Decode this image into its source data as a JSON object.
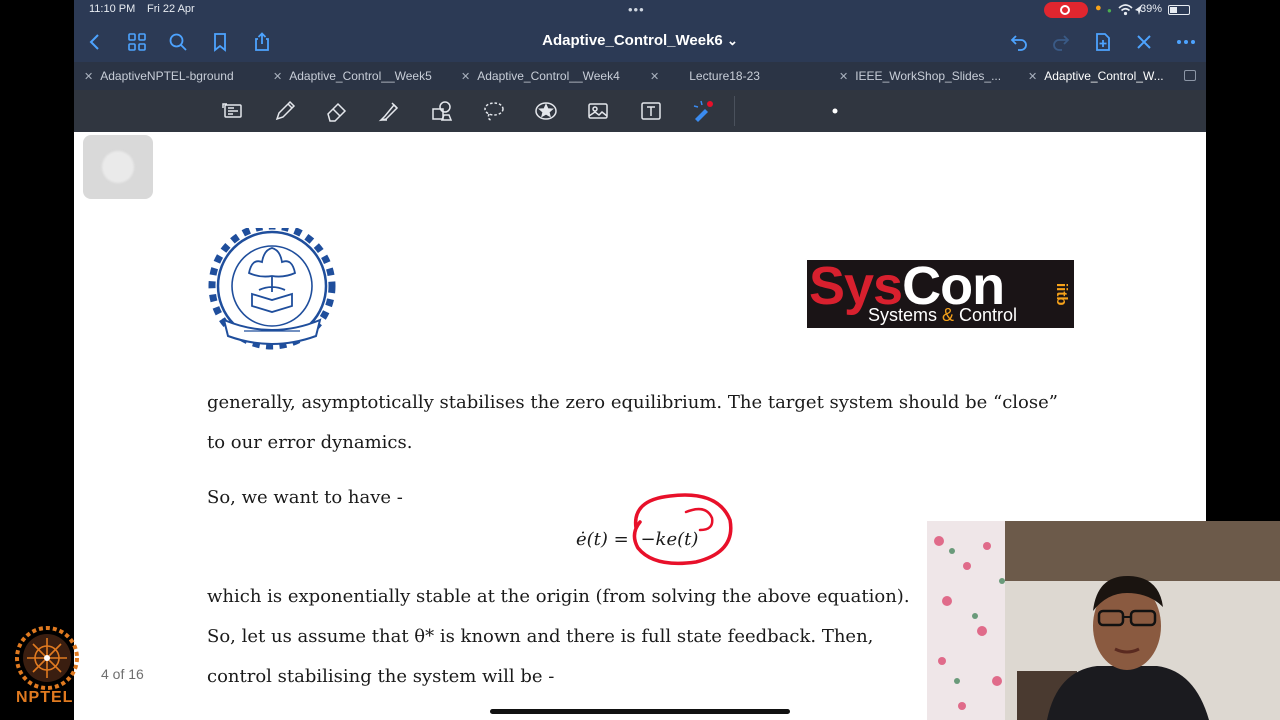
{
  "status_bar": {
    "time": "11:10 PM",
    "date": "Fri 22 Apr",
    "battery": "39%"
  },
  "nav": {
    "title": "Adaptive_Control_Week6",
    "chevron": "⌄"
  },
  "tabs": [
    {
      "label": "AdaptiveNPTEL-bground",
      "active": false
    },
    {
      "label": "Adaptive_Control__Week5",
      "active": false
    },
    {
      "label": "Adaptive_Control__Week4",
      "active": false
    },
    {
      "label": "Lecture18-23",
      "active": false
    },
    {
      "label": "IEEE_WorkShop_Slides_...",
      "active": false
    },
    {
      "label": "Adaptive_Control_W...",
      "active": true
    }
  ],
  "tools": [
    "scan-icon",
    "pen-icon",
    "eraser-icon",
    "highlighter-icon",
    "shapes-icon",
    "lasso-icon",
    "sticker-icon",
    "image-icon",
    "text-icon",
    "laser-icon"
  ],
  "logo": {
    "brand_part1": "Sys",
    "brand_part2": "Con",
    "tagline_part1": "Systems ",
    "tagline_amp": "&",
    "tagline_part2": " Control",
    "side_text": "iitb"
  },
  "content": {
    "line1": "generally, asymptotically stabilises the zero equilibrium.  The target system should be “close”",
    "line2": "to our error dynamics.",
    "line3": "So, we want to have -",
    "equation_lhs": "ė(t) =",
    "equation_rhs": "−ke(t)",
    "line4": "which is exponentially stable at the origin (from solving the above equation).",
    "line5": "So, let us assume that θ* is known and there is full state feedback.  Then,",
    "line6": "control stabilising the system will be -"
  },
  "page_indicator": "4 of 16",
  "watermark": {
    "label": "NPTEL"
  },
  "colors": {
    "accent": "#4da3ff",
    "annotation": "#e8102a",
    "record": "#e0262f",
    "brand_red": "#d8202e",
    "brand_orange": "#f6a21a"
  }
}
